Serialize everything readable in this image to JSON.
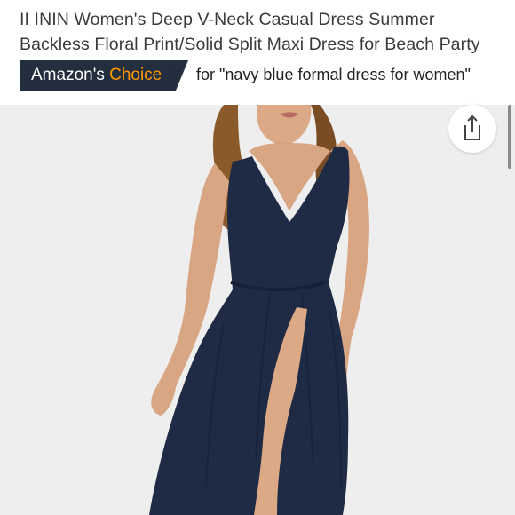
{
  "product": {
    "title": "II ININ Women's Deep V-Neck Casual Dress Summer Backless Floral Print/Solid Split Maxi Dress for Beach Party"
  },
  "badge": {
    "label_prefix": "Amazon's",
    "label_accent": "Choice",
    "query_text": "for \"navy blue formal dress for women\"",
    "bg_color": "#232f3e",
    "accent_color": "#ff9900"
  },
  "colors": {
    "dress": "#1f2b45",
    "background": "#eeeeee"
  },
  "icons": {
    "share": "share-icon"
  }
}
